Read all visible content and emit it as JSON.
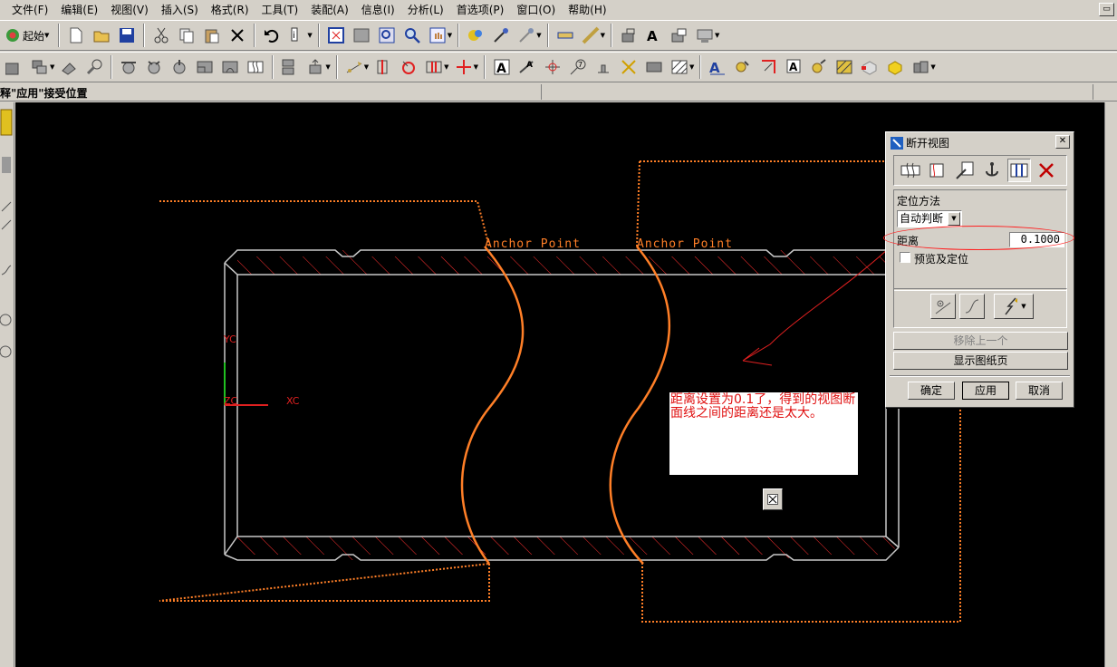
{
  "menubar": {
    "items": [
      "文件(F)",
      "编辑(E)",
      "视图(V)",
      "插入(S)",
      "格式(R)",
      "工具(T)",
      "装配(A)",
      "信息(I)",
      "分析(L)",
      "首选项(P)",
      "窗口(O)",
      "帮助(H)"
    ]
  },
  "toolbar": {
    "start_label": "起始"
  },
  "cue_line": {
    "text": "释\"应用\"接受位置"
  },
  "canvas": {
    "anchor_label_1": "Anchor Point",
    "anchor_label_2": "Anchor Point",
    "axis_yc": "YC",
    "axis_zc": "ZC",
    "axis_xc": "XC"
  },
  "note": {
    "text": "距离设置为0.1了，得到的视图断面线之间的距离还是太大。"
  },
  "dialog": {
    "title": "断开视图",
    "method_label": "定位方法",
    "method_value": "自动判断",
    "distance_label": "距离",
    "distance_value": "0.1000",
    "preview_label": "预览及定位",
    "remove_last_label": "移除上一个",
    "show_sheet_label": "显示图纸页",
    "ok_label": "确定",
    "apply_label": "应用",
    "cancel_label": "取消"
  },
  "colors": {
    "background": "#000000",
    "geometry": "#c8c8c8",
    "break_line": "#ff7f27",
    "hatch": "#ff3030",
    "note_text": "#e01010",
    "highlight": "#ff2020"
  }
}
